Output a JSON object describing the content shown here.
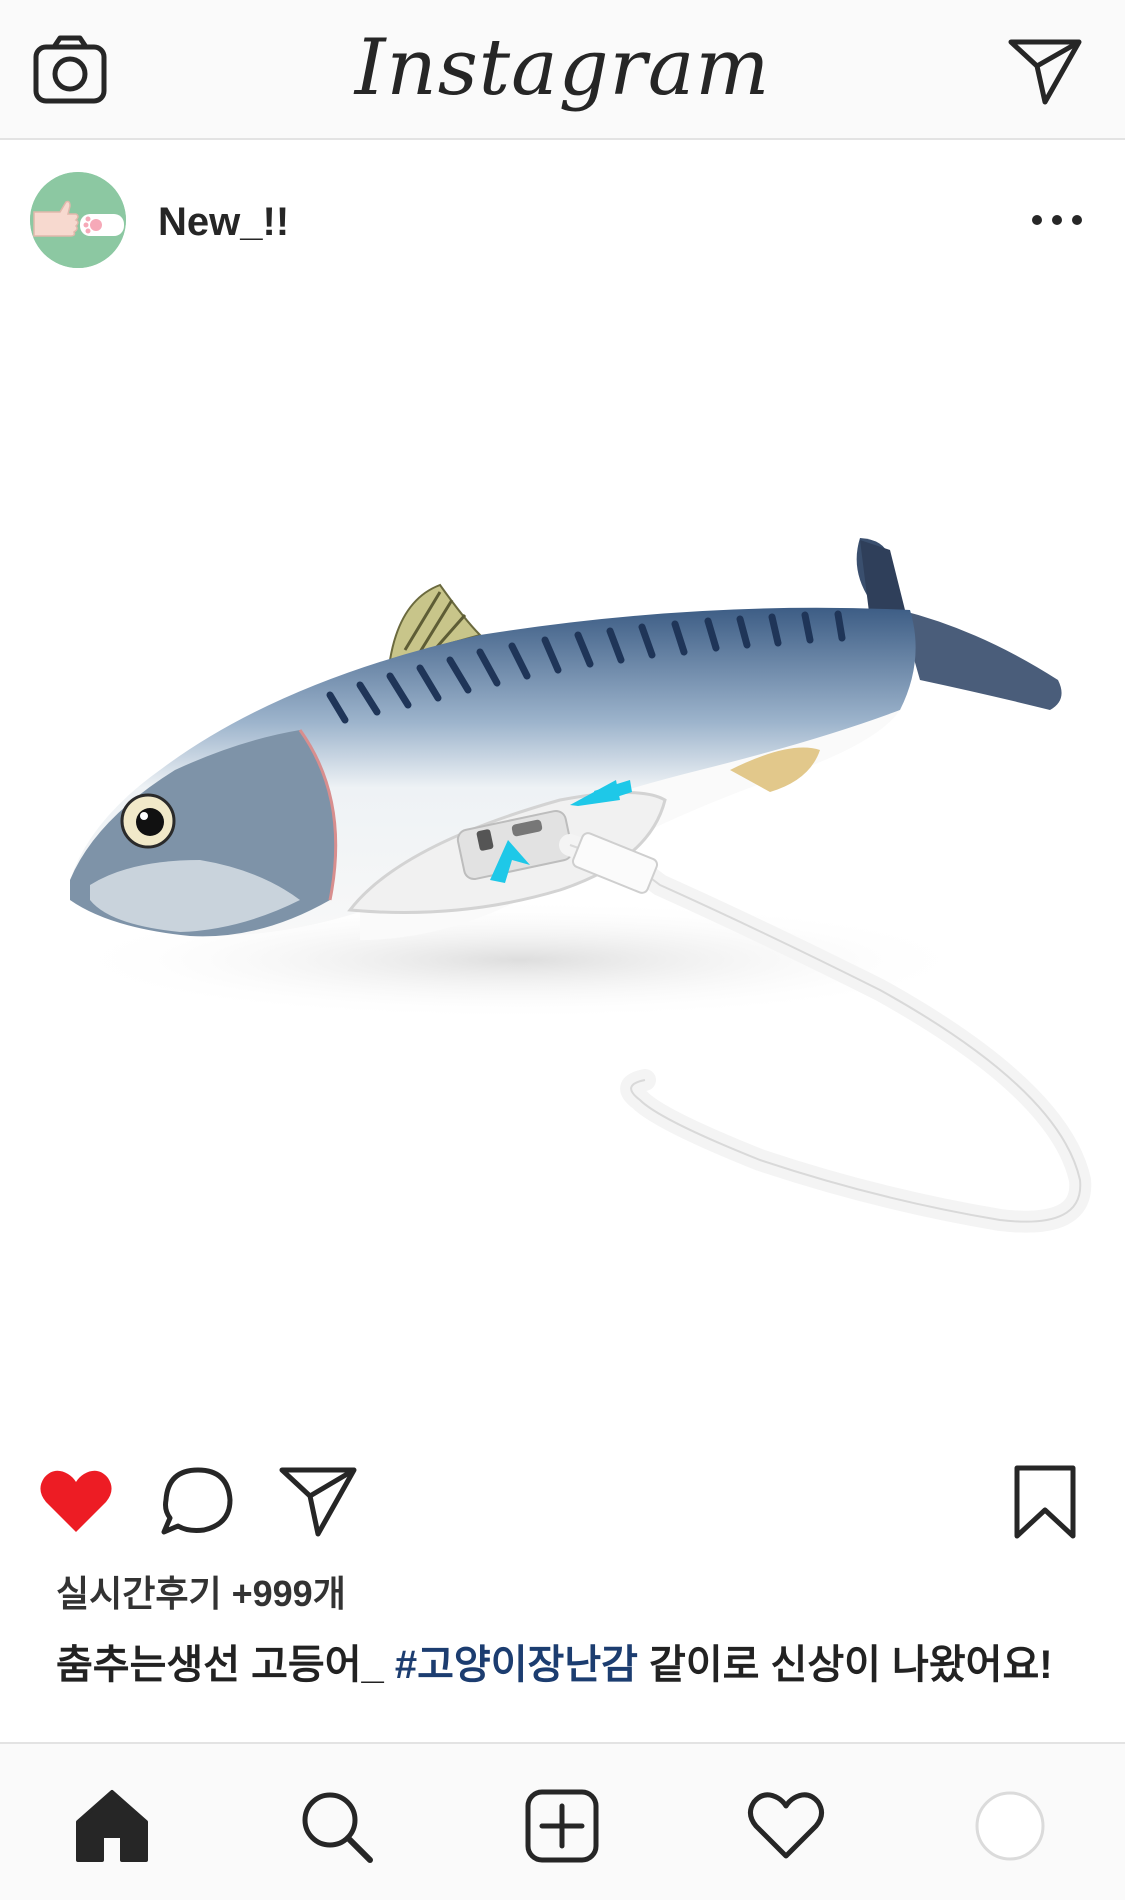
{
  "header": {
    "brand": "Instagram",
    "camera_icon": "camera-icon",
    "dm_icon": "paper-plane-icon"
  },
  "post": {
    "username": "New_!!",
    "avatar_icon": "hand-and-paw-avatar",
    "more_icon": "ellipsis-icon",
    "image_description_icon": "mackerel-toy-photo",
    "stats": "실시간후기 +999개",
    "caption": {
      "text_before": "춤추는생선 고등어_ ",
      "hashtag": "#고양이장난감",
      "text_after": " 같이로 신상이 나왔어요!"
    },
    "liked": true
  },
  "actions": {
    "like_icon": "heart-filled-icon",
    "comment_icon": "comment-icon",
    "share_icon": "paper-plane-icon",
    "save_icon": "bookmark-icon"
  },
  "nav": {
    "items": [
      {
        "name": "home",
        "icon": "home-filled-icon"
      },
      {
        "name": "search",
        "icon": "search-icon"
      },
      {
        "name": "add",
        "icon": "plus-square-icon"
      },
      {
        "name": "activity",
        "icon": "heart-outline-icon"
      },
      {
        "name": "profile",
        "icon": "profile-circle-icon"
      }
    ]
  },
  "colors": {
    "like_red": "#ed1c24",
    "hashtag_blue": "#1c3d70",
    "highlight_cyan": "#1ec8e8"
  }
}
